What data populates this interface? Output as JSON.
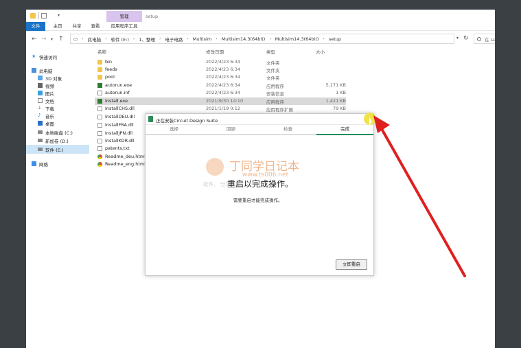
{
  "explorer": {
    "title": "setup",
    "manage_tab": "管理",
    "ribbon_tabs": [
      {
        "label": "文件"
      },
      {
        "label": "主页"
      },
      {
        "label": "共享"
      },
      {
        "label": "查看"
      },
      {
        "label": "应用程序工具"
      }
    ],
    "breadcrumb": [
      "此电脑",
      "软件 (E:)",
      "1、整理",
      "电子电路",
      "Multisim",
      "Multisim14.3(64bit)",
      "Multisim14.3(64bit)",
      "setup"
    ],
    "search_placeholder": "在 setup 中搜索",
    "nav_items": [
      {
        "label": "快速访问",
        "icon": "star-icon",
        "selected": false
      },
      {
        "label": "此电脑",
        "icon": "computer-icon",
        "selected": false
      },
      {
        "label": "3D 对象",
        "icon": "cube-icon",
        "selected": false
      },
      {
        "label": "视频",
        "icon": "video-icon",
        "selected": false
      },
      {
        "label": "图片",
        "icon": "picture-icon",
        "selected": false
      },
      {
        "label": "文档",
        "icon": "document-icon",
        "selected": false
      },
      {
        "label": "下载",
        "icon": "download-icon",
        "selected": false
      },
      {
        "label": "音乐",
        "icon": "music-icon",
        "selected": false
      },
      {
        "label": "桌面",
        "icon": "desktop-icon",
        "selected": false
      },
      {
        "label": "本地磁盘 (C:)",
        "icon": "drive-icon",
        "selected": false
      },
      {
        "label": "新加卷 (D:)",
        "icon": "drive-icon",
        "selected": false
      },
      {
        "label": "软件 (E:)",
        "icon": "drive-icon",
        "selected": true
      },
      {
        "label": "网络",
        "icon": "network-icon",
        "selected": false
      }
    ],
    "columns": {
      "name": "名称",
      "date": "修改日期",
      "type": "类型",
      "size": "大小"
    },
    "files": [
      {
        "name": "bin",
        "date": "2022/4/23 6:34",
        "type": "文件夹",
        "size": "",
        "icon": "folder-icon",
        "selected": false
      },
      {
        "name": "feeds",
        "date": "2022/4/23 6:34",
        "type": "文件夹",
        "size": "",
        "icon": "folder-icon",
        "selected": false
      },
      {
        "name": "pool",
        "date": "2022/4/23 6:34",
        "type": "文件夹",
        "size": "",
        "icon": "folder-icon",
        "selected": false
      },
      {
        "name": "autorun.exe",
        "date": "2022/4/23 6:34",
        "type": "应用程序",
        "size": "5,171 KB",
        "icon": "exe-icon",
        "selected": false
      },
      {
        "name": "autorun.inf",
        "date": "2022/4/23 6:34",
        "type": "安装信息",
        "size": "1 KB",
        "icon": "inf-icon",
        "selected": false
      },
      {
        "name": "Install.exe",
        "date": "2021/9/30 14:10",
        "type": "应用程序",
        "size": "1,421 KB",
        "icon": "exe-icon",
        "selected": true
      },
      {
        "name": "InstallCHS.dll",
        "date": "2021/1/19 0:12",
        "type": "应用程序扩展",
        "size": "79 KB",
        "icon": "dll-icon",
        "selected": false
      },
      {
        "name": "InstallDEU.dll",
        "date": "",
        "type": "",
        "size": "",
        "icon": "dll-icon",
        "selected": false
      },
      {
        "name": "InstallFRA.dll",
        "date": "",
        "type": "",
        "size": "",
        "icon": "dll-icon",
        "selected": false
      },
      {
        "name": "InstallJPN.dll",
        "date": "",
        "type": "",
        "size": "",
        "icon": "dll-icon",
        "selected": false
      },
      {
        "name": "InstallKOR.dll",
        "date": "",
        "type": "",
        "size": "",
        "icon": "dll-icon",
        "selected": false
      },
      {
        "name": "patents.txt",
        "date": "",
        "type": "",
        "size": "",
        "icon": "txt-icon",
        "selected": false
      },
      {
        "name": "Readme_deu.html",
        "date": "",
        "type": "",
        "size": "",
        "icon": "chrome-icon",
        "selected": false
      },
      {
        "name": "Readme_eng.html",
        "date": "",
        "type": "",
        "size": "",
        "icon": "chrome-icon",
        "selected": false
      }
    ]
  },
  "installer": {
    "title": "正在安装Circuit Design Suite",
    "close_label": "×",
    "tabs": [
      {
        "label": "选择",
        "active": false
      },
      {
        "label": "回顾",
        "active": false
      },
      {
        "label": "检查",
        "active": false
      },
      {
        "label": "完成",
        "active": true
      }
    ],
    "heading": "重启以完成操作。",
    "message": "需要重启才能完成操作。",
    "restart_button": "立即重启"
  },
  "watermark": {
    "title": "丁同学日记本",
    "url": "www.ts006.net",
    "tagline": "软件、           分享下载"
  },
  "colors": {
    "accent_blue": "#1a73c8",
    "manage_tab": "#d8c4ec",
    "installer_accent": "#1b8c60",
    "annotation_red": "#e02020",
    "cursor_highlight": "#f0e34a",
    "watermark_orange": "#e07020"
  }
}
